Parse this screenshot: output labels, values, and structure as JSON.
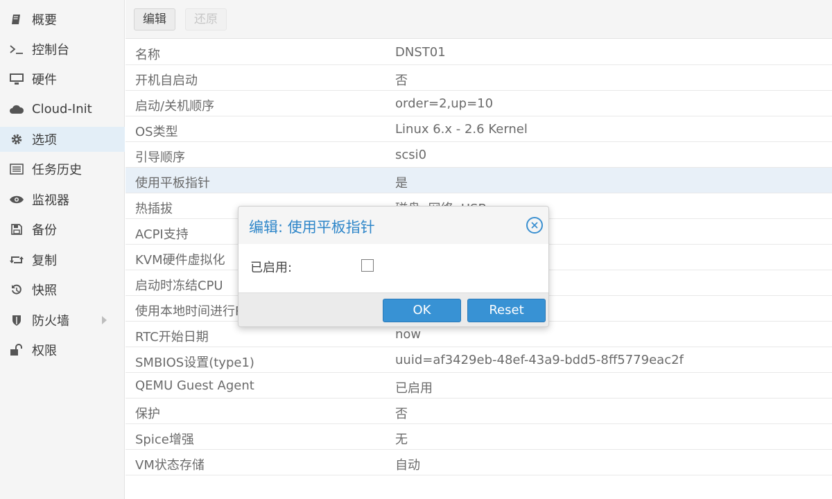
{
  "sidebar": {
    "items": [
      {
        "label": "概要",
        "icon": "book-icon"
      },
      {
        "label": "控制台",
        "icon": "terminal-icon"
      },
      {
        "label": "硬件",
        "icon": "monitor-icon"
      },
      {
        "label": "Cloud-Init",
        "icon": "cloud-icon"
      },
      {
        "label": "选项",
        "icon": "gear-icon",
        "active": true
      },
      {
        "label": "任务历史",
        "icon": "list-icon"
      },
      {
        "label": "监视器",
        "icon": "eye-icon"
      },
      {
        "label": "备份",
        "icon": "floppy-icon"
      },
      {
        "label": "复制",
        "icon": "retweet-icon"
      },
      {
        "label": "快照",
        "icon": "history-icon"
      },
      {
        "label": "防火墙",
        "icon": "shield-icon",
        "has_submenu": true
      },
      {
        "label": "权限",
        "icon": "unlock-icon"
      }
    ]
  },
  "toolbar": {
    "edit_label": "编辑",
    "revert_label": "还原"
  },
  "properties": [
    {
      "name": "名称",
      "value": "DNST01"
    },
    {
      "name": "开机自启动",
      "value": "否"
    },
    {
      "name": "启动/关机顺序",
      "value": "order=2,up=10"
    },
    {
      "name": "OS类型",
      "value": "Linux 6.x - 2.6 Kernel"
    },
    {
      "name": "引导顺序",
      "value": "scsi0"
    },
    {
      "name": "使用平板指针",
      "value": "是",
      "selected": true
    },
    {
      "name": "热插拔",
      "value": "磁盘, 网络, USB"
    },
    {
      "name": "ACPI支持",
      "value": ""
    },
    {
      "name": "KVM硬件虚拟化",
      "value": ""
    },
    {
      "name": "启动时冻结CPU",
      "value": ""
    },
    {
      "name": "使用本地时间进行RTC",
      "value": ""
    },
    {
      "name": "RTC开始日期",
      "value": "now"
    },
    {
      "name": "SMBIOS设置(type1)",
      "value": "uuid=af3429eb-48ef-43a9-bdd5-8ff5779eac2f"
    },
    {
      "name": "QEMU Guest Agent",
      "value": "已启用"
    },
    {
      "name": "保护",
      "value": "否"
    },
    {
      "name": "Spice增强",
      "value": "无"
    },
    {
      "name": "VM状态存储",
      "value": "自动"
    }
  ],
  "dialog": {
    "title": "编辑: 使用平板指针",
    "field_label": "已启用:",
    "checked": false,
    "ok_label": "OK",
    "reset_label": "Reset",
    "close_icon": "close-circle-icon"
  },
  "colors": {
    "accent": "#3892d4",
    "title_blue": "#2e86c9",
    "selected_row": "#e8f0f8",
    "active_nav": "#e3eef7"
  }
}
